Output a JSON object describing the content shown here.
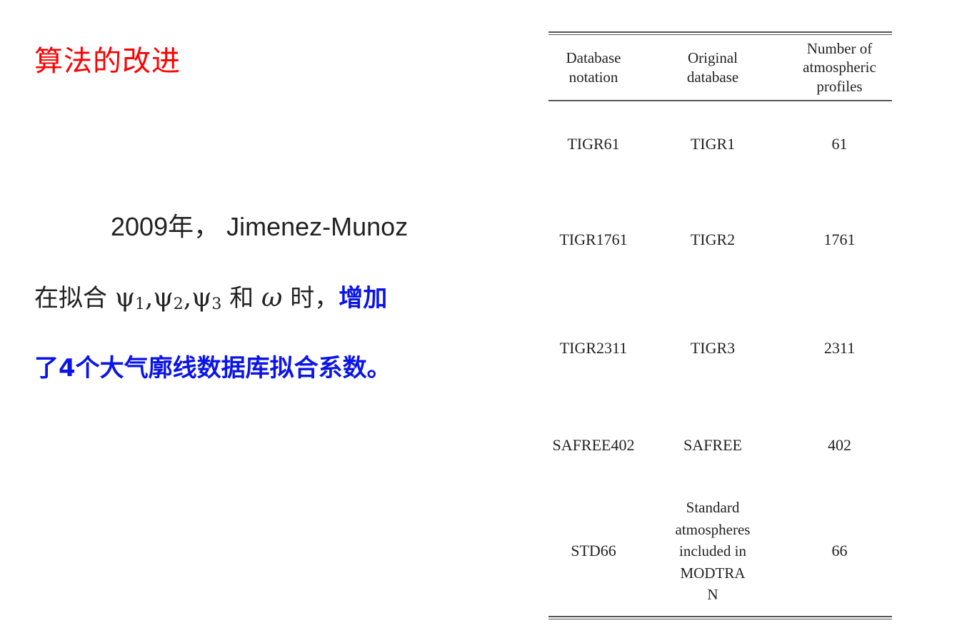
{
  "title": "算法的改进",
  "para": {
    "year": "2009",
    "year_suffix": "年，",
    "author": "Jimenez-Munoz",
    "fit_prefix": "在拟合",
    "psi": "ψ",
    "sub1": "1",
    "sub2": "2",
    "sub3": "3",
    "sep": ",",
    "and": "和",
    "omega": "ω",
    "time": "时，",
    "highlight1": "增加",
    "highlight2": "了4个大气廓线数据库拟合系数。"
  },
  "table": {
    "headers": {
      "col1": [
        "Database",
        "notation"
      ],
      "col2": [
        "Original",
        "database"
      ],
      "col3": [
        "Number of",
        "atmospheric",
        "profiles"
      ]
    },
    "rows": [
      {
        "notation": "TIGR61",
        "original": "TIGR1",
        "count": "61"
      },
      {
        "notation": "TIGR1761",
        "original": "TIGR2",
        "count": "1761"
      },
      {
        "notation": "TIGR2311",
        "original": "TIGR3",
        "count": "2311"
      },
      {
        "notation": "SAFREE402",
        "original": "SAFREE",
        "count": "402"
      },
      {
        "notation": "STD66",
        "original_lines": [
          "Standard",
          "atmospheres",
          "included in",
          "MODTRA",
          "N"
        ],
        "count": "66"
      }
    ]
  }
}
